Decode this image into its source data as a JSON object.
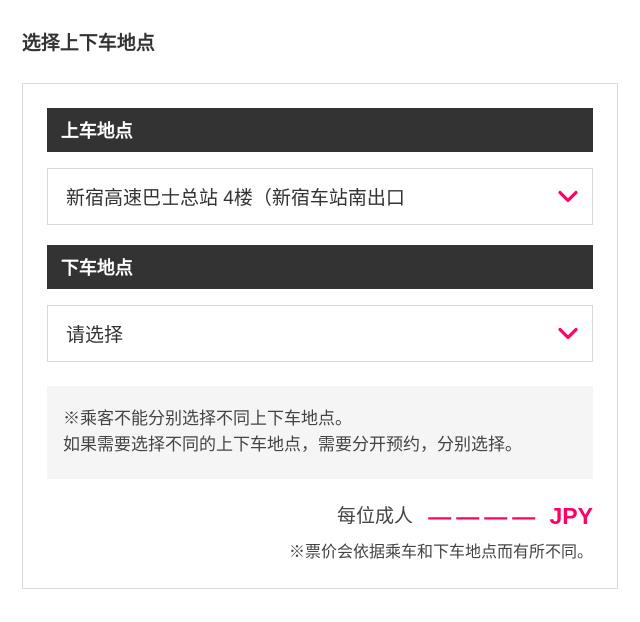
{
  "page": {
    "title": "选择上下车地点"
  },
  "boarding": {
    "header": "上车地点",
    "selected": "新宿高速巴士总站 4楼（新宿车站南出口"
  },
  "alighting": {
    "header": "下车地点",
    "placeholder": "请选择"
  },
  "note": {
    "line1": "※乘客不能分别选择不同上下车地点。",
    "line2": "如果需要选择不同的上下车地点，需要分开预约，分别选择。"
  },
  "price": {
    "label": "每位成人",
    "value_dashes": "――――",
    "currency": "JPY",
    "disclaimer": "※票价会依据乘车和下车地点而有所不同。"
  },
  "accent_color": "#ff0066"
}
